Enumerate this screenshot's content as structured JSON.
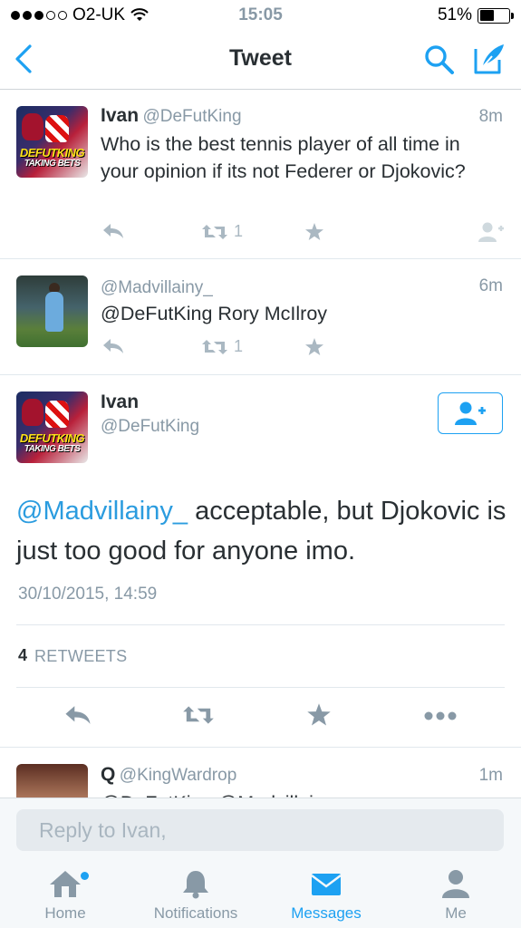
{
  "status_bar": {
    "carrier": "O2-UK",
    "time": "15:05",
    "battery": "51%",
    "battery_level": 0.51
  },
  "nav": {
    "title": "Tweet",
    "back_icon": "chevron-left-icon",
    "search_icon": "search-icon",
    "compose_icon": "compose-icon"
  },
  "tweets": [
    {
      "name": "Ivan",
      "handle": "@DeFutKing",
      "time": "8m",
      "text": "Who is the best tennis player of all time in your opinion if its not Federer or Djokovic?",
      "retweets": "1",
      "avatar_text": "DEFUTKING",
      "avatar_subtext": "TAKING BETS"
    },
    {
      "name": "",
      "handle": "@Madvillainy_",
      "time": "6m",
      "text": "@DeFutKing Rory McIlroy",
      "retweets": "1"
    }
  ],
  "main_tweet": {
    "name": "Ivan",
    "handle": "@DeFutKing",
    "mention": "@Madvillainy_",
    "text": " acceptable, but Djokovic is just too good for anyone imo.",
    "timestamp": "30/10/2015, 14:59",
    "retweet_count": "4",
    "retweet_label": "RETWEETS"
  },
  "next_tweet": {
    "name": "Q",
    "handle": "@KingWardrop",
    "time": "1m",
    "text": "@DeFutKing @Madvillainy"
  },
  "reply": {
    "placeholder": "Reply to Ivan,"
  },
  "tabs": [
    {
      "label": "Home",
      "icon": "home-icon",
      "active": false
    },
    {
      "label": "Notifications",
      "icon": "bell-icon",
      "active": false
    },
    {
      "label": "Messages",
      "icon": "envelope-icon",
      "active": true
    },
    {
      "label": "Me",
      "icon": "person-icon",
      "active": false
    }
  ],
  "colors": {
    "accent": "#1da1f2",
    "muted": "#8899a6",
    "text": "#292f33"
  }
}
